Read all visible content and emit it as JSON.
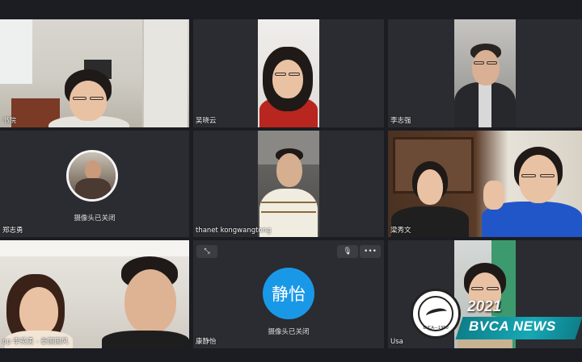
{
  "participants": [
    {
      "name": "书院",
      "camera_off": false
    },
    {
      "name": "吴晓云",
      "camera_off": false
    },
    {
      "name": "李志强",
      "camera_off": false
    },
    {
      "name": "郑志勇",
      "camera_off": true,
      "camera_off_text": "摄像头已关闭"
    },
    {
      "name": "thanet   kongwangtong",
      "camera_off": false
    },
    {
      "name": "梁秀文",
      "camera_off": false
    },
    {
      "name": "op 李英勇 - 泰国国风",
      "camera_off": false
    },
    {
      "name": "康静怡",
      "camera_off": true,
      "camera_off_text": "摄像头已关闭",
      "initials": "静怡"
    },
    {
      "name": "Usa",
      "camera_off": false
    }
  ],
  "tile_controls": {
    "expand_icon": "expand-icon",
    "mic_icon": "microphone-icon",
    "more_icon": "more-options-icon",
    "expand_glyph": "⤡",
    "mic_glyph": "🎙",
    "more_glyph": "•••"
  },
  "watermark": {
    "year": "2021",
    "brand": "BVCA NEWS",
    "seal_text": "BVCA—1950"
  },
  "colors": {
    "background": "#1b1d22",
    "tile": "#2a2c31",
    "avatar_initials": "#1a98e8",
    "banner": "#17a8b5"
  }
}
